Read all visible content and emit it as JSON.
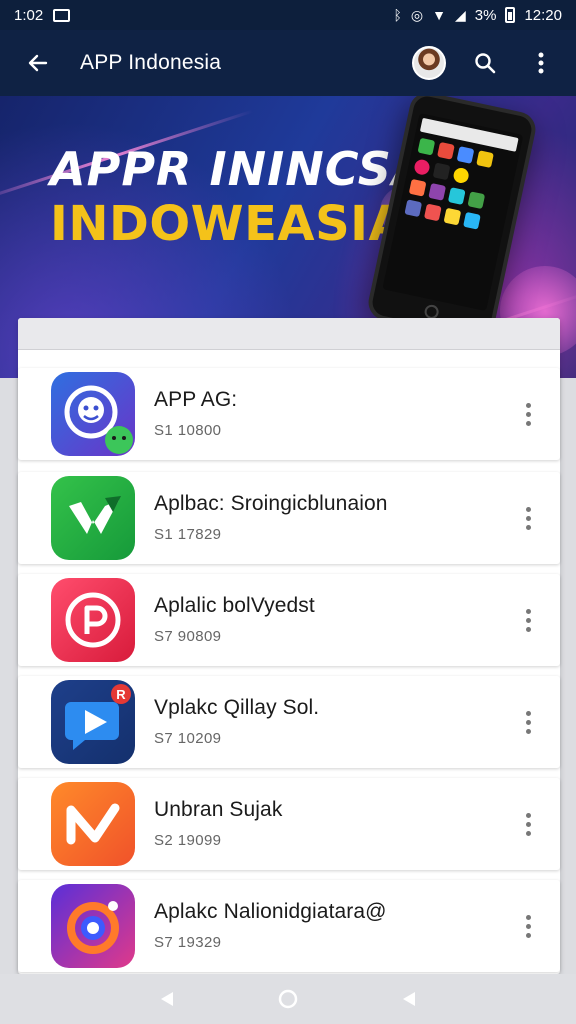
{
  "status_bar": {
    "time_left": "1:02",
    "battery": "3%",
    "time_right": "12:20",
    "icons": [
      "notification-icon",
      "bluetooth-icon",
      "alarm-icon",
      "wifi-icon",
      "signal-icon",
      "battery-icon"
    ]
  },
  "app_bar": {
    "title": "APP Indonesia",
    "icons": [
      "back-arrow-icon",
      "avatar",
      "search-icon",
      "more-vert-icon"
    ]
  },
  "banner": {
    "line1": "APPR ININCSA",
    "line2": "INDOWEASIA"
  },
  "apps": [
    {
      "name": "APP AG:",
      "meta": "S1 10800",
      "icon": "chat-face-icon",
      "colors": [
        "#2f6fe0",
        "#6a35c8"
      ]
    },
    {
      "name": "Aplbac: Sroingicblunaion",
      "meta": "S1 17829",
      "icon": "green-leaf-icon",
      "colors": [
        "#34c24a",
        "#169a3a"
      ]
    },
    {
      "name": "Aplalic bolVyedst",
      "meta": "S7 90809",
      "icon": "red-p-icon",
      "colors": [
        "#ff4d6d",
        "#d81b3b"
      ]
    },
    {
      "name": "Vplakc Qillay Sol.",
      "meta": "S7 10209",
      "icon": "play-chat-icon",
      "colors": [
        "#1e3f8a",
        "#14306d"
      ]
    },
    {
      "name": "Unbran Sujak",
      "meta": "S2 19099",
      "icon": "orange-n-icon",
      "colors": [
        "#ff8a2a",
        "#f0522a"
      ]
    },
    {
      "name": "Aplakc Nalionidgiatara@",
      "meta": "S7 19329",
      "icon": "purple-ring-icon",
      "colors": [
        "#5a2fd8",
        "#e0398a"
      ]
    }
  ],
  "nav": [
    "back-triangle-icon",
    "home-circle-icon",
    "recents-triangle-icon"
  ]
}
